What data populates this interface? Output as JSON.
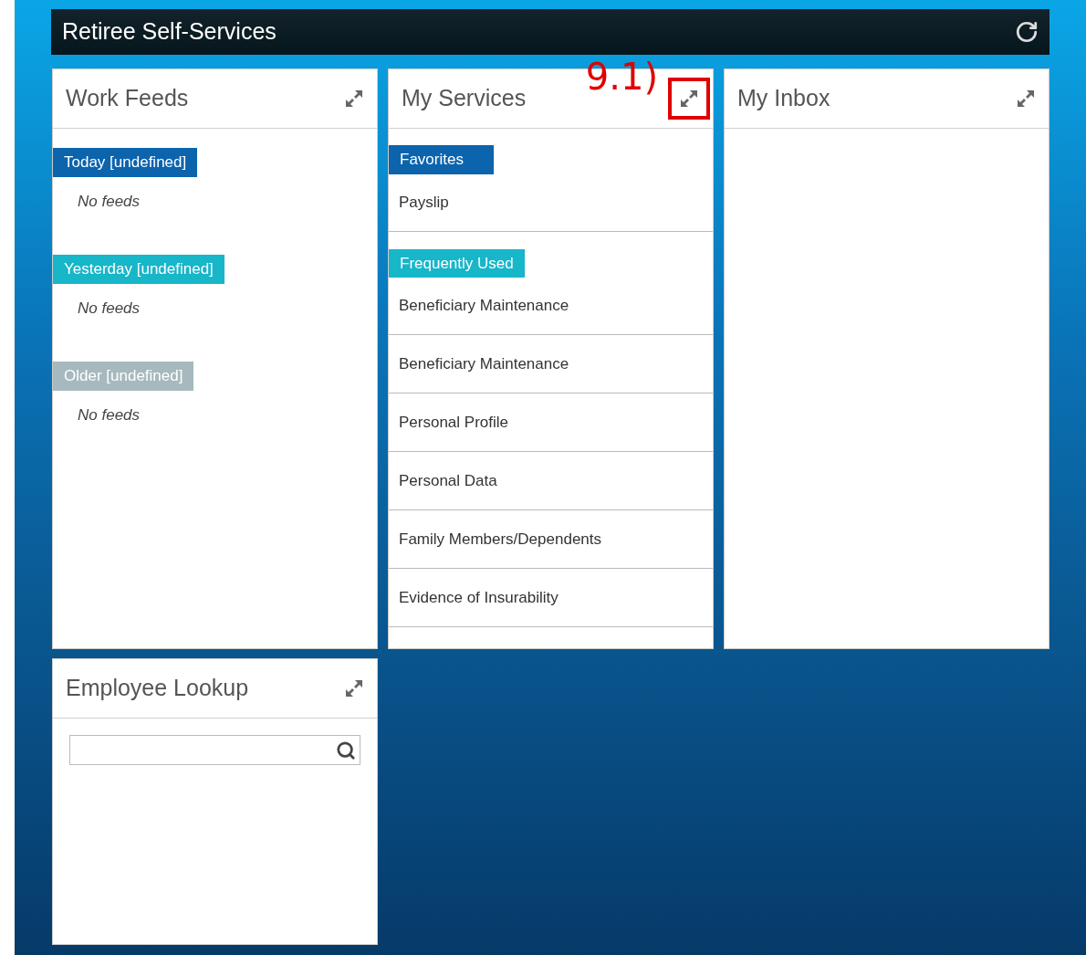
{
  "header": {
    "title": "Retiree Self-Services"
  },
  "tiles": [
    {
      "kind": "feeds",
      "title": "Work Feeds",
      "expand_highlighted": false,
      "groups": [
        {
          "label": "Today [undefined]",
          "color": "#0c64ad",
          "empty_text": "No feeds"
        },
        {
          "label": "Yesterday [undefined]",
          "color": "#17b6c9",
          "empty_text": "No feeds"
        },
        {
          "label": "Older [undefined]",
          "color": "#a6b9be",
          "empty_text": "No feeds"
        }
      ]
    },
    {
      "kind": "services",
      "title": "My Services",
      "expand_highlighted": true,
      "annotation": "9.1)",
      "sections": [
        {
          "label": "Favorites",
          "color": "#0c64ad",
          "items": [
            "Payslip"
          ]
        },
        {
          "label": "Frequently Used",
          "color": "#17b6c9",
          "items": [
            "Beneficiary Maintenance",
            "Beneficiary Maintenance",
            "Personal Profile",
            "Personal Data",
            "Family Members/Dependents",
            "Evidence of Insurability"
          ]
        }
      ]
    },
    {
      "kind": "inbox",
      "title": "My Inbox",
      "expand_highlighted": false
    },
    {
      "kind": "lookup",
      "title": "Employee Lookup",
      "expand_highlighted": false
    }
  ]
}
